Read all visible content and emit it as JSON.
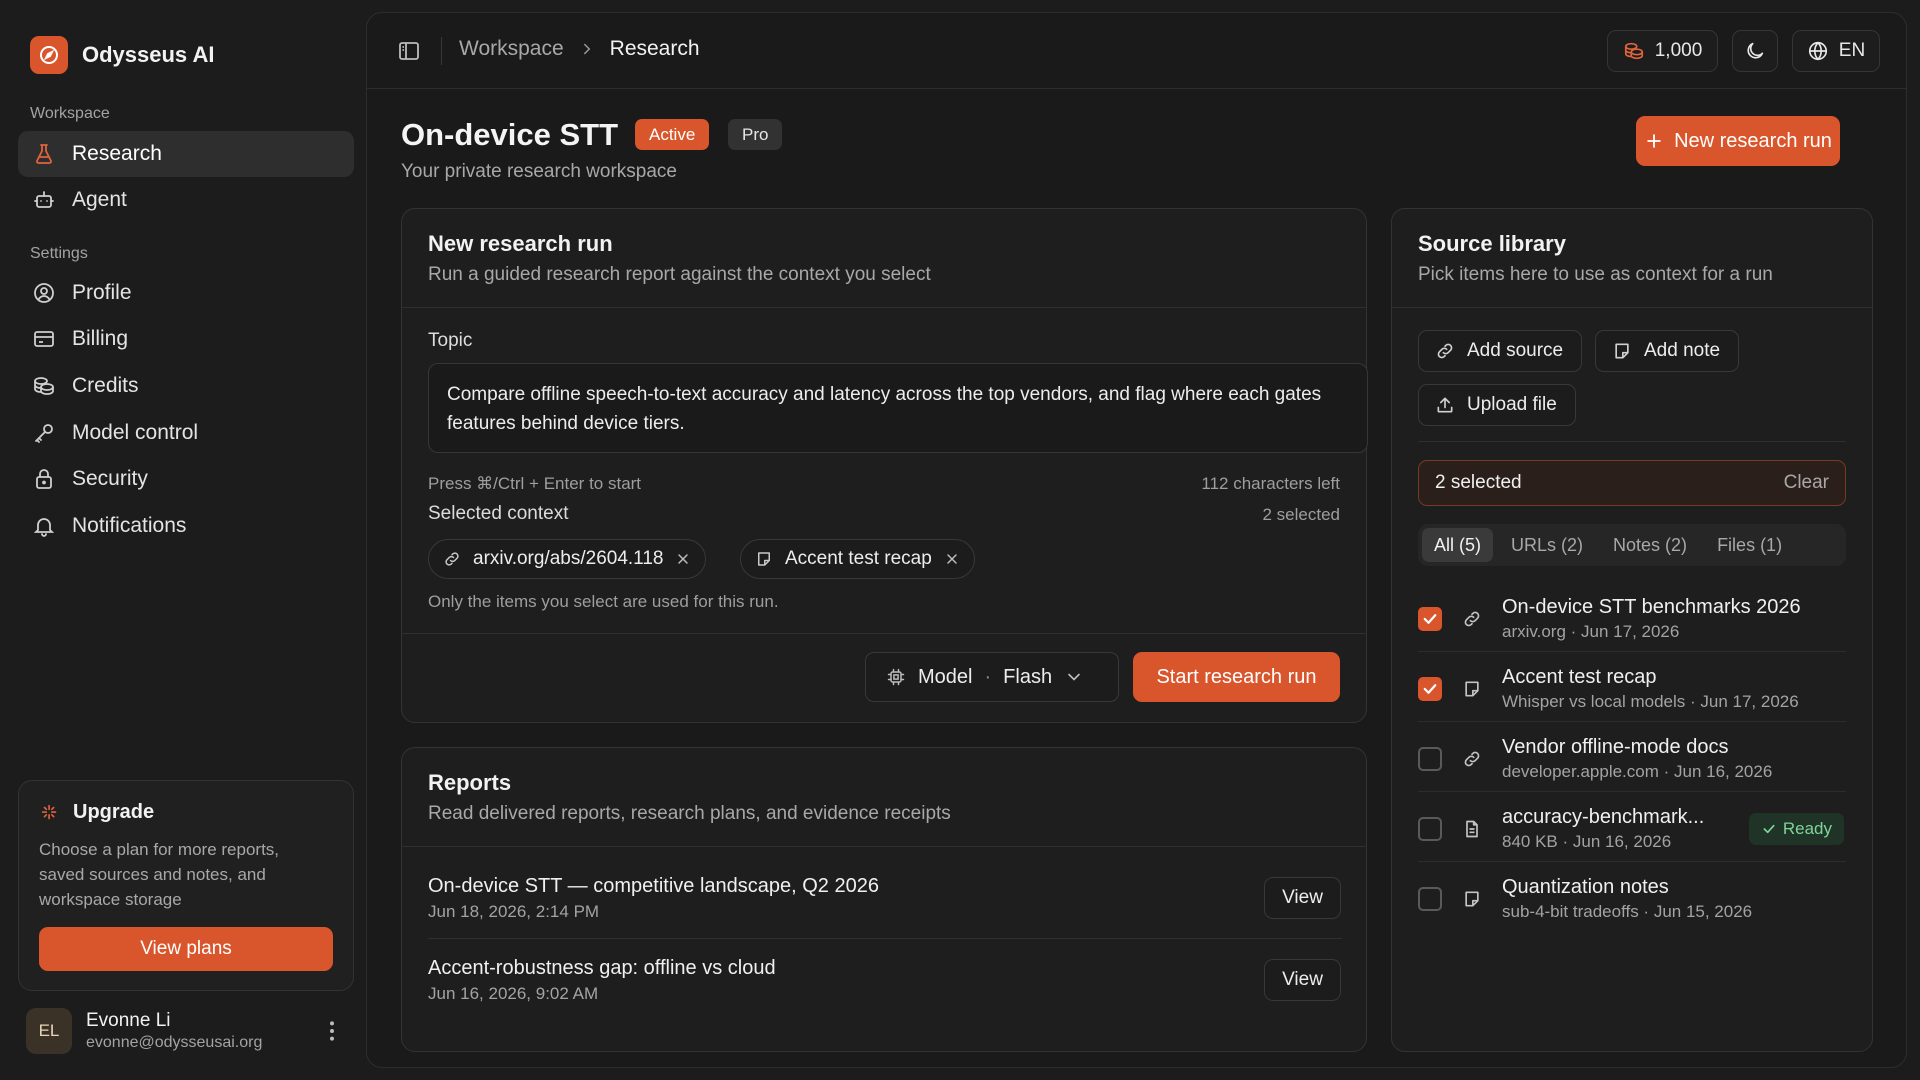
{
  "brand": {
    "name": "Odysseus AI"
  },
  "sidebar": {
    "workspace_heading": "Workspace",
    "workspace_items": [
      {
        "label": "Research",
        "icon": "flask-icon",
        "active": true
      },
      {
        "label": "Agent",
        "icon": "bot-icon",
        "active": false
      }
    ],
    "settings_heading": "Settings",
    "settings_items": [
      {
        "label": "Profile",
        "icon": "user-circle-icon"
      },
      {
        "label": "Billing",
        "icon": "credit-card-icon"
      },
      {
        "label": "Credits",
        "icon": "coins-icon"
      },
      {
        "label": "Model control",
        "icon": "key-icon"
      },
      {
        "label": "Security",
        "icon": "lock-icon"
      },
      {
        "label": "Notifications",
        "icon": "bell-icon"
      }
    ],
    "upgrade": {
      "title": "Upgrade",
      "description": "Choose a plan for more reports, saved sources and notes, and workspace storage",
      "button": "View plans"
    },
    "user": {
      "initials": "EL",
      "name": "Evonne Li",
      "email": "evonne@odysseusai.org"
    }
  },
  "topbar": {
    "breadcrumb_root": "Workspace",
    "breadcrumb_current": "Research",
    "credits": "1,000",
    "language": "EN"
  },
  "page": {
    "title": "On-device STT",
    "status_badge": "Active",
    "plan_badge": "Pro",
    "subtitle": "Your private research workspace",
    "new_run_button": "New research run"
  },
  "run_card": {
    "title": "New research run",
    "subtitle": "Run a guided research report against the context you select",
    "topic_label": "Topic",
    "topic_value": "Compare offline speech-to-text accuracy and latency across the top vendors, and flag where each gates features behind device tiers.",
    "shortcut_hint": "Press ⌘/Ctrl + Enter to start",
    "chars_left": "112 characters left",
    "context_label": "Selected context",
    "context_count": "2 selected",
    "context_items": [
      {
        "label": "arxiv.org/abs/2604.118",
        "icon": "link-icon"
      },
      {
        "label": "Accent test recap",
        "icon": "note-icon"
      }
    ],
    "context_hint": "Only the items you select are used for this run.",
    "model_label": "Model",
    "model_dot": "·",
    "model_value": "Flash",
    "start_button": "Start research run"
  },
  "reports": {
    "title": "Reports",
    "subtitle": "Read delivered reports, research plans, and evidence receipts",
    "items": [
      {
        "title": "On-device STT — competitive landscape, Q2 2026",
        "date": "Jun 18, 2026, 2:14 PM",
        "action": "View"
      },
      {
        "title": "Accent-robustness gap: offline vs cloud",
        "date": "Jun 16, 2026, 9:02 AM",
        "action": "View"
      }
    ]
  },
  "library": {
    "title": "Source library",
    "subtitle": "Pick items here to use as context for a run",
    "add_source": "Add source",
    "add_note": "Add note",
    "upload_file": "Upload file",
    "selected_text": "2 selected",
    "clear": "Clear",
    "tabs": [
      {
        "label": "All (5)",
        "active": true
      },
      {
        "label": "URLs (2)",
        "active": false
      },
      {
        "label": "Notes (2)",
        "active": false
      },
      {
        "label": "Files (1)",
        "active": false
      }
    ],
    "items": [
      {
        "title": "On-device STT benchmarks 2026",
        "meta": "arxiv.org · Jun 17, 2026",
        "type": "link-icon",
        "checked": true
      },
      {
        "title": "Accent test recap",
        "meta": "Whisper vs local models · Jun 17, 2026",
        "type": "note-icon",
        "checked": true
      },
      {
        "title": "Vendor offline-mode docs",
        "meta": "developer.apple.com · Jun 16, 2026",
        "type": "link-icon",
        "checked": false
      },
      {
        "title": "accuracy-benchmark...",
        "meta": "840 KB · Jun 16, 2026",
        "type": "file-icon",
        "checked": false,
        "status": "Ready"
      },
      {
        "title": "Quantization notes",
        "meta": "sub-4-bit tradeoffs · Jun 15, 2026",
        "type": "note-icon",
        "checked": false
      }
    ]
  },
  "colors": {
    "accent": "#d9562c",
    "background": "#1c1c1c",
    "ready": "#7fd49a"
  }
}
